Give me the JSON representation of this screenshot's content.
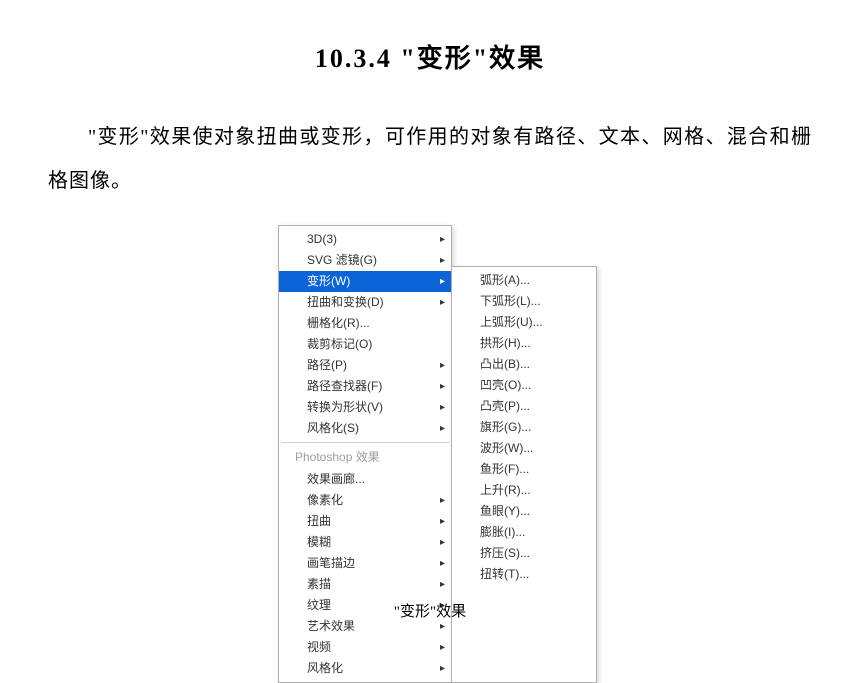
{
  "title": "10.3.4  \"变形\"效果",
  "paragraph": "\"变形\"效果使对象扭曲或变形，可作用的对象有路径、文本、网格、混合和栅格图像。",
  "caption": "\"变形\"效果",
  "menu": {
    "left_group1": [
      {
        "label": "3D(3)",
        "submenu": true
      },
      {
        "label": "SVG 滤镜(G)",
        "submenu": true
      },
      {
        "label": "变形(W)",
        "submenu": true,
        "highlighted": true
      },
      {
        "label": "扭曲和变换(D)",
        "submenu": true
      },
      {
        "label": "栅格化(R)...",
        "submenu": false
      },
      {
        "label": "裁剪标记(O)",
        "submenu": false
      },
      {
        "label": "路径(P)",
        "submenu": true
      },
      {
        "label": "路径查找器(F)",
        "submenu": true
      },
      {
        "label": "转换为形状(V)",
        "submenu": true
      },
      {
        "label": "风格化(S)",
        "submenu": true
      }
    ],
    "section_label": "Photoshop 效果",
    "left_group2": [
      {
        "label": "效果画廊...",
        "submenu": false
      },
      {
        "label": "像素化",
        "submenu": true
      },
      {
        "label": "扭曲",
        "submenu": true
      },
      {
        "label": "模糊",
        "submenu": true
      },
      {
        "label": "画笔描边",
        "submenu": true
      },
      {
        "label": "素描",
        "submenu": true
      },
      {
        "label": "纹理",
        "submenu": true
      },
      {
        "label": "艺术效果",
        "submenu": true
      },
      {
        "label": "视频",
        "submenu": true
      },
      {
        "label": "风格化",
        "submenu": true
      }
    ],
    "right": [
      {
        "label": "弧形(A)..."
      },
      {
        "label": "下弧形(L)..."
      },
      {
        "label": "上弧形(U)..."
      },
      {
        "label": "拱形(H)..."
      },
      {
        "label": "凸出(B)..."
      },
      {
        "label": "凹壳(O)..."
      },
      {
        "label": "凸壳(P)..."
      },
      {
        "label": "旗形(G)..."
      },
      {
        "label": "波形(W)..."
      },
      {
        "label": "鱼形(F)..."
      },
      {
        "label": "上升(R)..."
      },
      {
        "label": "鱼眼(Y)..."
      },
      {
        "label": "膨胀(I)..."
      },
      {
        "label": "挤压(S)..."
      },
      {
        "label": "扭转(T)..."
      }
    ]
  }
}
